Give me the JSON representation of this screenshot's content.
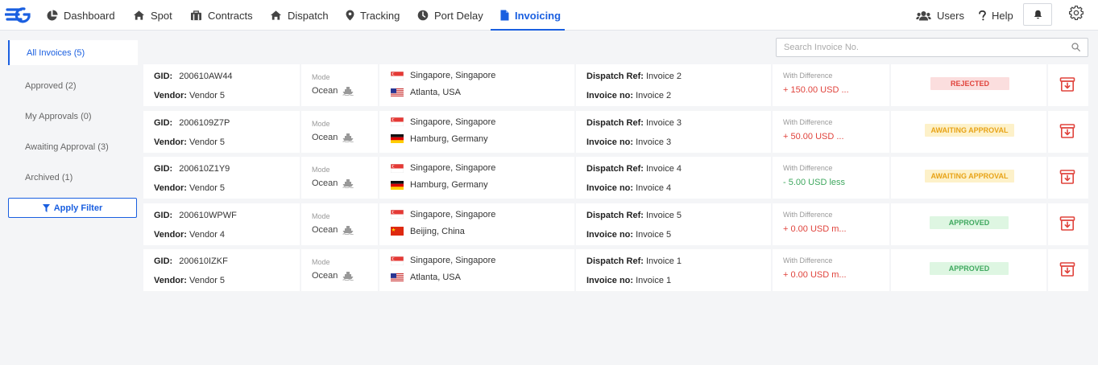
{
  "nav": {
    "items": [
      {
        "label": "Dashboard",
        "icon": "pie-chart-icon"
      },
      {
        "label": "Spot",
        "icon": "home-icon"
      },
      {
        "label": "Contracts",
        "icon": "contracts-icon"
      },
      {
        "label": "Dispatch",
        "icon": "dispatch-icon"
      },
      {
        "label": "Tracking",
        "icon": "map-pin-icon"
      },
      {
        "label": "Port Delay",
        "icon": "clock-icon"
      },
      {
        "label": "Invoicing",
        "icon": "file-icon"
      }
    ],
    "active": "Invoicing",
    "users_label": "Users",
    "help_label": "Help"
  },
  "sidebar": {
    "items": [
      {
        "label": "All Invoices (5)"
      },
      {
        "label": "Approved (2)"
      },
      {
        "label": "My Approvals (0)"
      },
      {
        "label": "Awaiting Approval (3)"
      },
      {
        "label": "Archived (1)"
      }
    ],
    "apply_filter_label": "Apply Filter"
  },
  "search": {
    "placeholder": "Search Invoice No.",
    "value": ""
  },
  "labels": {
    "gid": "GID:",
    "vendor": "Vendor:",
    "mode": "Mode",
    "dispatch_ref": "Dispatch Ref:",
    "invoice_no": "Invoice no:",
    "with_difference": "With Difference"
  },
  "colors": {
    "accent": "#1a5fe0",
    "rejected": "#e0433c",
    "awaiting": "#e8a317",
    "approved": "#3fa85f"
  },
  "invoices": [
    {
      "gid": "200610AW44",
      "vendor": "Vendor 5",
      "mode": "Ocean",
      "origin": "Singapore, Singapore",
      "origin_flag": "sg",
      "destination": "Atlanta, USA",
      "destination_flag": "us",
      "dispatch_ref": "Invoice 2",
      "invoice_no": "Invoice 2",
      "difference": "+ 150.00 USD ...",
      "difference_type": "neg",
      "status": "REJECTED",
      "status_type": "rejected"
    },
    {
      "gid": "2006109Z7P",
      "vendor": "Vendor 5",
      "mode": "Ocean",
      "origin": "Singapore, Singapore",
      "origin_flag": "sg",
      "destination": "Hamburg, Germany",
      "destination_flag": "de",
      "dispatch_ref": "Invoice 3",
      "invoice_no": "Invoice 3",
      "difference": "+ 50.00 USD ...",
      "difference_type": "neg",
      "status": "AWAITING APPROVAL",
      "status_type": "awaiting"
    },
    {
      "gid": "200610Z1Y9",
      "vendor": "Vendor 5",
      "mode": "Ocean",
      "origin": "Singapore, Singapore",
      "origin_flag": "sg",
      "destination": "Hamburg, Germany",
      "destination_flag": "de",
      "dispatch_ref": "Invoice 4",
      "invoice_no": "Invoice 4",
      "difference": "- 5.00 USD less",
      "difference_type": "pos",
      "status": "AWAITING APPROVAL",
      "status_type": "awaiting"
    },
    {
      "gid": "200610WPWF",
      "vendor": "Vendor 4",
      "mode": "Ocean",
      "origin": "Singapore, Singapore",
      "origin_flag": "sg",
      "destination": "Beijing, China",
      "destination_flag": "cn",
      "dispatch_ref": "Invoice 5",
      "invoice_no": "Invoice 5",
      "difference": "+ 0.00 USD m...",
      "difference_type": "neg",
      "status": "APPROVED",
      "status_type": "approved"
    },
    {
      "gid": "200610IZKF",
      "vendor": "Vendor 5",
      "mode": "Ocean",
      "origin": "Singapore, Singapore",
      "origin_flag": "sg",
      "destination": "Atlanta, USA",
      "destination_flag": "us",
      "dispatch_ref": "Invoice 1",
      "invoice_no": "Invoice 1",
      "difference": "+ 0.00 USD m...",
      "difference_type": "neg",
      "status": "APPROVED",
      "status_type": "approved"
    }
  ]
}
